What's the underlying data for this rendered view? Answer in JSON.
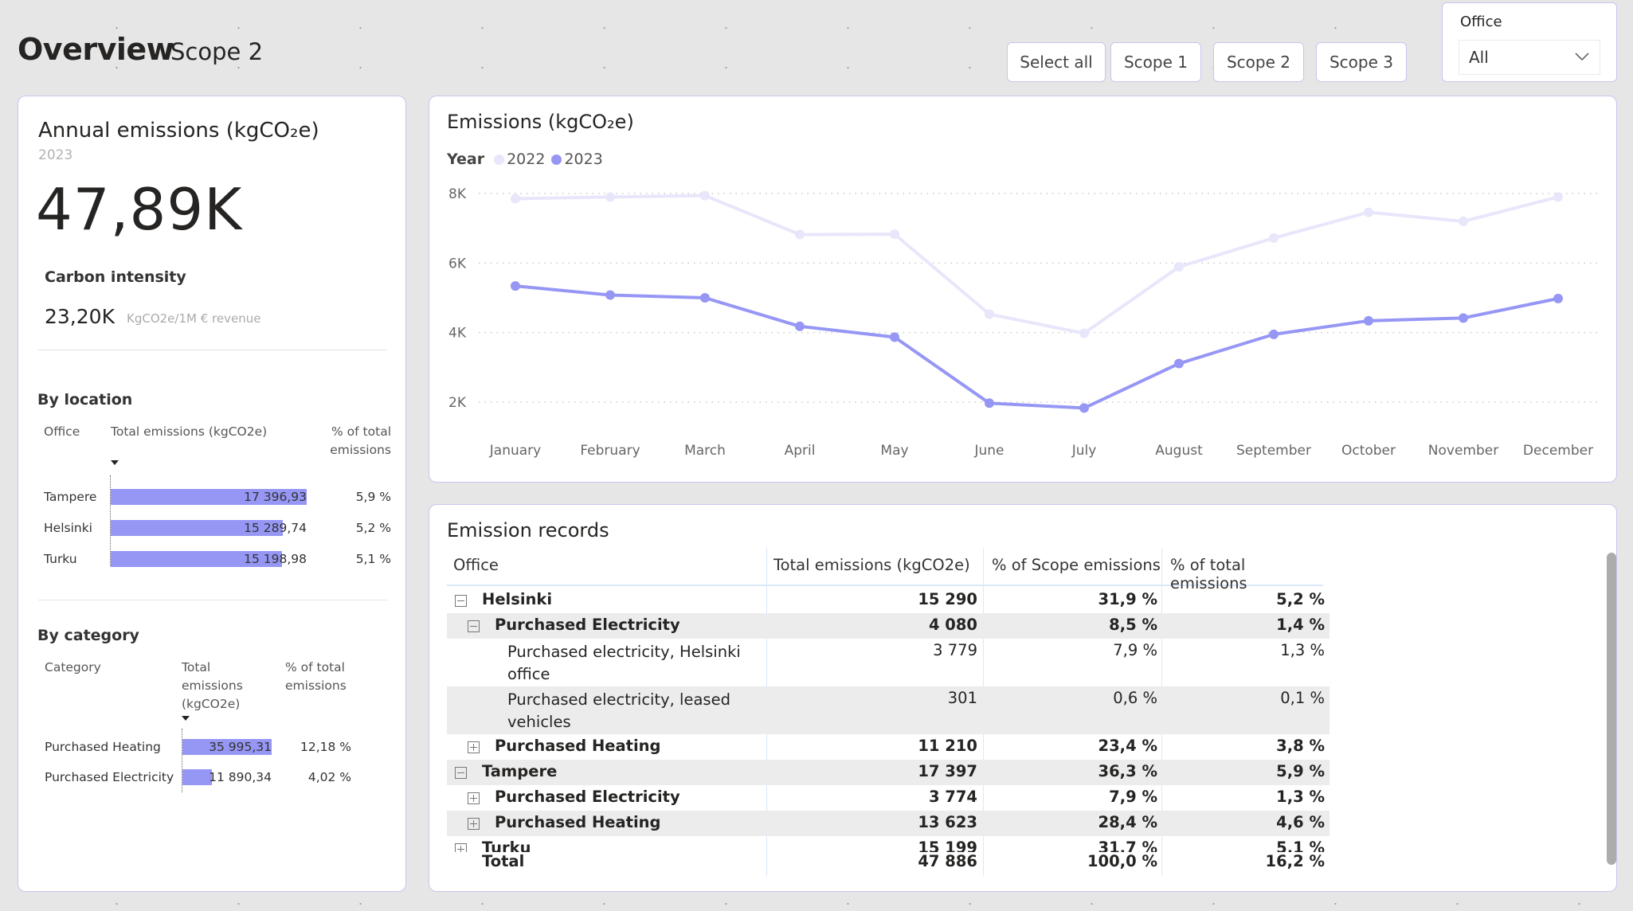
{
  "header": {
    "title": "Overview",
    "subtitle": "Scope 2"
  },
  "scope_buttons": [
    "Select all",
    "Scope 1",
    "Scope 2",
    "Scope 3"
  ],
  "office_slicer": {
    "label": "Office",
    "value": "All",
    "icon": "chevron-down-icon"
  },
  "kpi": {
    "title": "Annual emissions (kgCO₂e)",
    "year": "2023",
    "value": "47,89K",
    "carbon_intensity_label": "Carbon intensity",
    "carbon_intensity_value": "23,20K",
    "carbon_intensity_unit": "KgCO2e/1M € revenue"
  },
  "by_location": {
    "title": "By location",
    "headers": [
      "Office",
      "Total emissions (kgCO2e)",
      "% of total\nemissions"
    ],
    "header_pct_lines": [
      "% of total",
      "emissions"
    ],
    "rows": [
      {
        "office": "Tampere",
        "value": 17396.93,
        "value_label": "17 396,93",
        "pct": "5,9 %"
      },
      {
        "office": "Helsinki",
        "value": 15289.74,
        "value_label": "15 289,74",
        "pct": "5,2 %"
      },
      {
        "office": "Turku",
        "value": 15198.98,
        "value_label": "15 198,98",
        "pct": "5,1 %"
      }
    ]
  },
  "by_category": {
    "title": "By category",
    "header_category": "Category",
    "header_total_lines": [
      "Total",
      "emissions",
      "(kgCO2e)"
    ],
    "header_pct_lines": [
      "% of total",
      "emissions"
    ],
    "rows": [
      {
        "category": "Purchased Heating",
        "value": 35995.31,
        "value_label": "35 995,31",
        "pct": "12,18 %"
      },
      {
        "category": "Purchased Electricity",
        "value": 11890.34,
        "value_label": "11 890,34",
        "pct": "4,02 %"
      }
    ]
  },
  "chart_data": {
    "type": "line",
    "title": "Emissions (kgCO₂e)",
    "legend_title": "Year",
    "legend_position": "top-left",
    "categories": [
      "January",
      "February",
      "March",
      "April",
      "May",
      "June",
      "July",
      "August",
      "September",
      "October",
      "November",
      "December"
    ],
    "series": [
      {
        "name": "2022",
        "color": "#e8e6fb",
        "values": [
          7850,
          7900,
          7940,
          6820,
          6830,
          4530,
          3980,
          5890,
          6720,
          7460,
          7200,
          7900
        ]
      },
      {
        "name": "2023",
        "color": "#9696f5",
        "values": [
          5340,
          5080,
          5000,
          4180,
          3870,
          1970,
          1830,
          3110,
          3950,
          4340,
          4420,
          4980
        ]
      }
    ],
    "yticks": [
      2000,
      4000,
      6000,
      8000
    ],
    "ytick_labels": [
      "2K",
      "4K",
      "6K",
      "8K"
    ],
    "ylim": [
      0,
      8000
    ],
    "grid": true,
    "xlabel": "",
    "ylabel": ""
  },
  "records": {
    "title": "Emission records",
    "columns": [
      "Office",
      "Total emissions (kgCO2e)",
      "% of Scope emissions",
      "% of total emissions"
    ],
    "rows": [
      {
        "level": 0,
        "expander": "minus",
        "label": "Helsinki",
        "total": "15 290",
        "scope_pct": "31,9 %",
        "total_pct": "5,2 %",
        "bold": true
      },
      {
        "level": 1,
        "expander": "minus",
        "label": "Purchased Electricity",
        "total": "4 080",
        "scope_pct": "8,5 %",
        "total_pct": "1,4 %",
        "bold": true
      },
      {
        "level": 2,
        "expander": "none",
        "label": "Purchased electricity, Helsinki office",
        "label_lines": [
          "Purchased electricity, Helsinki",
          "office"
        ],
        "total": "3 779",
        "scope_pct": "7,9 %",
        "total_pct": "1,3 %",
        "bold": false
      },
      {
        "level": 2,
        "expander": "none",
        "label": "Purchased electricity, leased vehicles",
        "label_lines": [
          "Purchased electricity, leased",
          "vehicles"
        ],
        "total": "301",
        "scope_pct": "0,6 %",
        "total_pct": "0,1 %",
        "bold": false
      },
      {
        "level": 1,
        "expander": "plus",
        "label": "Purchased Heating",
        "total": "11 210",
        "scope_pct": "23,4 %",
        "total_pct": "3,8 %",
        "bold": true
      },
      {
        "level": 0,
        "expander": "minus",
        "label": "Tampere",
        "total": "17 397",
        "scope_pct": "36,3 %",
        "total_pct": "5,9 %",
        "bold": true
      },
      {
        "level": 1,
        "expander": "plus",
        "label": "Purchased Electricity",
        "total": "3 774",
        "scope_pct": "7,9 %",
        "total_pct": "1,3 %",
        "bold": true
      },
      {
        "level": 1,
        "expander": "plus",
        "label": "Purchased Heating",
        "total": "13 623",
        "scope_pct": "28,4 %",
        "total_pct": "4,6 %",
        "bold": true
      },
      {
        "level": 0,
        "expander": "plus",
        "label": "Turku",
        "total": "15 199",
        "scope_pct": "31,7 %",
        "total_pct": "5,1 %",
        "bold": true
      }
    ],
    "total": {
      "label": "Total",
      "total": "47 886",
      "scope_pct": "100,0 %",
      "total_pct": "16,2 %"
    }
  }
}
